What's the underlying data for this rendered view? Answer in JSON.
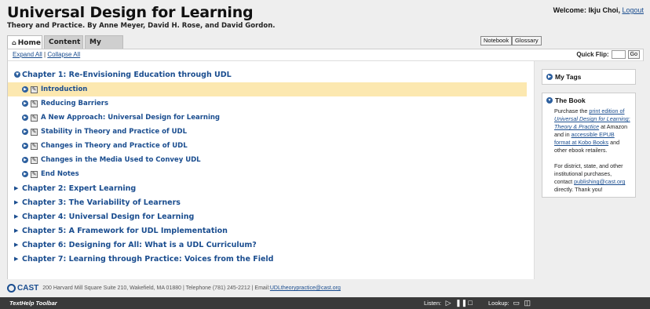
{
  "header": {
    "title": "Universal Design for Learning",
    "subtitle": "Theory and Practice. By Anne Meyer, David H. Rose, and David Gordon.",
    "welcome_label": "Welcome: Ikju Choi,",
    "logout_label": "Logout"
  },
  "tabs": [
    {
      "label": "Home",
      "icon": "home-icon",
      "active": true
    },
    {
      "label": "Content",
      "active": false
    },
    {
      "label": "My Tags",
      "active": false
    }
  ],
  "buttons": {
    "notebook": "Notebook",
    "glossary": "Glossary"
  },
  "toolbar": {
    "expand_all": "Expand All",
    "separator": "|",
    "collapse_all": "Collapse All",
    "quick_flip_label": "Quick Flip:",
    "quick_flip_value": "",
    "go_label": "Go"
  },
  "toc": {
    "chapter1": {
      "title": "Chapter 1: Re-Envisioning Education through UDL",
      "sections": [
        "Introduction",
        "Reducing Barriers",
        "A New Approach: Universal Design for Learning",
        "Stability in Theory and Practice of UDL",
        "Changes in Theory and Practice of UDL",
        "Changes in the Media Used to Convey UDL",
        "End Notes"
      ]
    },
    "chapters": [
      "Chapter 2: Expert Learning",
      "Chapter 3: The Variability of Learners",
      "Chapter 4: Universal Design for Learning",
      "Chapter 5: A Framework for UDL Implementation",
      "Chapter 6: Designing for All: What is a UDL Curriculum?",
      "Chapter 7: Learning through Practice: Voices from the Field"
    ]
  },
  "sidebar": {
    "my_tags": "My Tags",
    "book_heading": "The Book",
    "para1_a": "Purchase the ",
    "para1_link1": "print edition of",
    "para1_link1b": "Universal Design for Learning: Theory & Practice",
    "para1_b": " at Amazon and in ",
    "para1_link2": "accessible EPUB format at Kobo Books",
    "para1_c": " and other ebook retailers.",
    "para2_a": "For district, state, and other institutional purchases, contact ",
    "para2_link": "publishing@cast.org",
    "para2_b": " directly. Thank you!"
  },
  "footer": {
    "logo_text": "CAST",
    "address": "200 Harvard Mill Square Suite 210, Wakefield, MA 01880 | Telephone (781) 245-2212 | Email: ",
    "email": "UDLtheorypractice@cast.org"
  },
  "texthelp": {
    "title": "TextHelp Toolbar",
    "listen_label": "Listen:",
    "lookup_label": "Lookup:"
  },
  "colors": {
    "link": "#1a4d8f",
    "highlight": "#fce8b0",
    "toolbar_bg": "#3a3a3a"
  }
}
